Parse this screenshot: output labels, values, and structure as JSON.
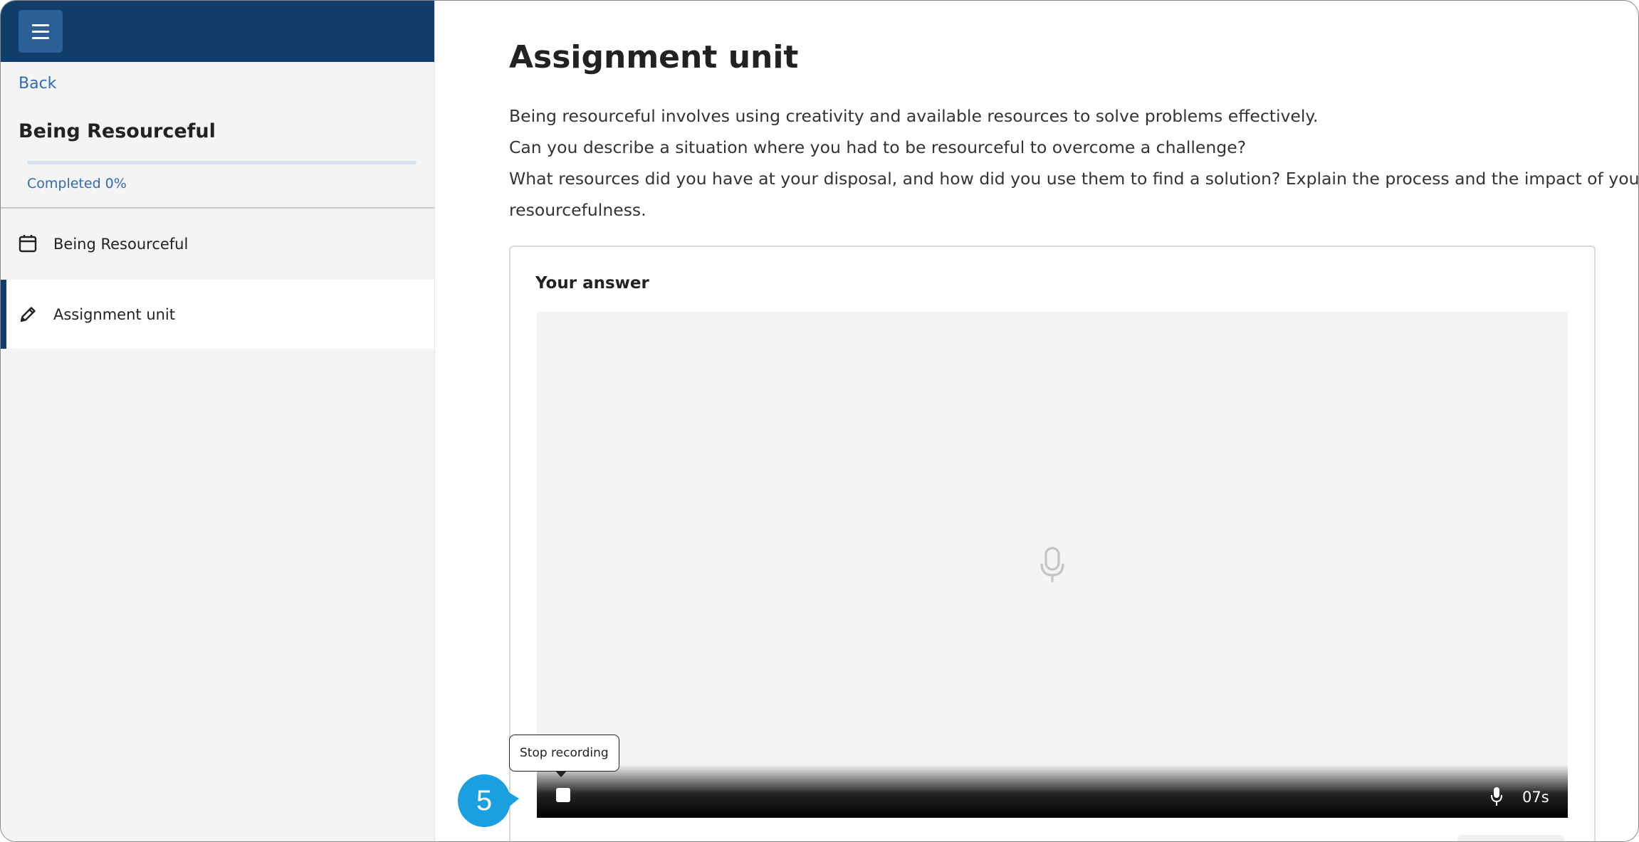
{
  "sidebar": {
    "menu_icon": "hamburger-menu-icon",
    "back_label": "Back",
    "course_title": "Being Resourceful",
    "progress": {
      "completed_label": "Completed 0%",
      "percent": 0
    },
    "items": [
      {
        "label": "Being Resourceful",
        "icon": "calendar-box-icon",
        "active": false
      },
      {
        "label": "Assignment unit",
        "icon": "pencil-icon",
        "active": true
      }
    ]
  },
  "main": {
    "title": "Assignment unit",
    "question_lines": [
      "Being resourceful involves using creativity and available resources to solve problems effectively.",
      "Can you describe a situation where you had to be resourceful to overcome a challenge?",
      "What resources did you have at your disposal, and how did you use them to find a solution? Explain the process and the impact of your",
      "resourcefulness."
    ],
    "answer": {
      "label": "Your answer",
      "recorder": {
        "placeholder_icon": "microphone-icon",
        "stop_icon": "stop-icon",
        "mic_icon": "microphone-icon",
        "timer": "07s",
        "tooltip": "Stop recording"
      }
    }
  },
  "annotation": {
    "step_number": "5",
    "color": "#1a9fe0"
  },
  "colors": {
    "brand_dark": "#113d6b",
    "brand_button": "#2d5f97",
    "link": "#2d6db5"
  }
}
